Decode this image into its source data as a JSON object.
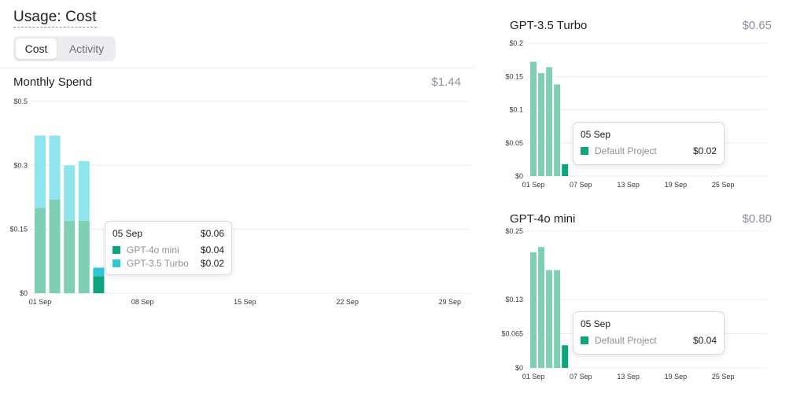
{
  "header": {
    "title": "Usage: Cost"
  },
  "tabs": [
    {
      "label": "Cost",
      "active": true
    },
    {
      "label": "Activity",
      "active": false
    }
  ],
  "colors": {
    "gpt4o_mini": "#80cfb2",
    "gpt4o_mini_highlight": "#10a37f",
    "gpt35": "#8fe5ee",
    "gpt35_highlight": "#2ec9d4",
    "grid": "#ececf1"
  },
  "monthly": {
    "title": "Monthly Spend",
    "total": "$1.44",
    "tooltip": {
      "date": "05 Sep",
      "total": "$0.06",
      "rows": [
        {
          "name": "GPT-4o mini",
          "value": "$0.04",
          "icon": "square-swatch-icon"
        },
        {
          "name": "GPT-3.5 Turbo",
          "value": "$0.02",
          "icon": "square-swatch-icon"
        }
      ]
    }
  },
  "gpt35": {
    "title": "GPT-3.5 Turbo",
    "total": "$0.65",
    "tooltip": {
      "date": "05 Sep",
      "rows": [
        {
          "name": "Default Project",
          "value": "$0.02"
        }
      ]
    }
  },
  "gpt4o": {
    "title": "GPT-4o mini",
    "total": "$0.80",
    "tooltip": {
      "date": "05 Sep",
      "rows": [
        {
          "name": "Default Project",
          "value": "$0.04"
        }
      ]
    }
  },
  "chart_data": [
    {
      "type": "bar",
      "stacked": true,
      "title": "Monthly Spend",
      "x": [
        "01 Sep",
        "02 Sep",
        "03 Sep",
        "04 Sep",
        "05 Sep"
      ],
      "x_ticks": [
        "01 Sep",
        "08 Sep",
        "15 Sep",
        "22 Sep",
        "29 Sep"
      ],
      "x_range_days": 30,
      "y_ticks": [
        "$0",
        "$0.15",
        "$0.3",
        "$0.5"
      ],
      "y_tick_values": [
        0,
        0.15,
        0.3,
        0.45
      ],
      "ylim": [
        0,
        0.45
      ],
      "grid": true,
      "highlight_index": 4,
      "series": [
        {
          "name": "GPT-4o mini",
          "values": [
            0.2,
            0.22,
            0.17,
            0.17,
            0.04
          ]
        },
        {
          "name": "GPT-3.5 Turbo",
          "values": [
            0.17,
            0.15,
            0.13,
            0.14,
            0.02
          ]
        }
      ]
    },
    {
      "type": "bar",
      "title": "GPT-3.5 Turbo",
      "x": [
        "01 Sep",
        "02 Sep",
        "03 Sep",
        "04 Sep",
        "05 Sep"
      ],
      "x_ticks": [
        "01 Sep",
        "07 Sep",
        "13 Sep",
        "19 Sep",
        "25 Sep"
      ],
      "x_range_days": 30,
      "y_ticks": [
        "$0",
        "$0.05",
        "$0.1",
        "$0.15",
        "$0.2"
      ],
      "y_tick_values": [
        0,
        0.05,
        0.1,
        0.15,
        0.2
      ],
      "ylim": [
        0,
        0.2
      ],
      "grid": true,
      "highlight_index": 4,
      "series": [
        {
          "name": "GPT-3.5 Turbo",
          "values": [
            0.172,
            0.155,
            0.164,
            0.138,
            0.018
          ]
        }
      ]
    },
    {
      "type": "bar",
      "title": "GPT-4o mini",
      "x": [
        "01 Sep",
        "02 Sep",
        "03 Sep",
        "04 Sep",
        "05 Sep"
      ],
      "x_ticks": [
        "01 Sep",
        "07 Sep",
        "13 Sep",
        "19 Sep",
        "25 Sep"
      ],
      "x_range_days": 30,
      "y_ticks": [
        "$0",
        "$0.065",
        "$0.13",
        "$0.25"
      ],
      "y_tick_values": [
        0,
        0.065,
        0.13,
        0.26
      ],
      "ylim": [
        0,
        0.26
      ],
      "grid": true,
      "highlight_index": 4,
      "series": [
        {
          "name": "GPT-4o mini",
          "values": [
            0.22,
            0.23,
            0.186,
            0.186,
            0.043
          ]
        }
      ]
    }
  ]
}
